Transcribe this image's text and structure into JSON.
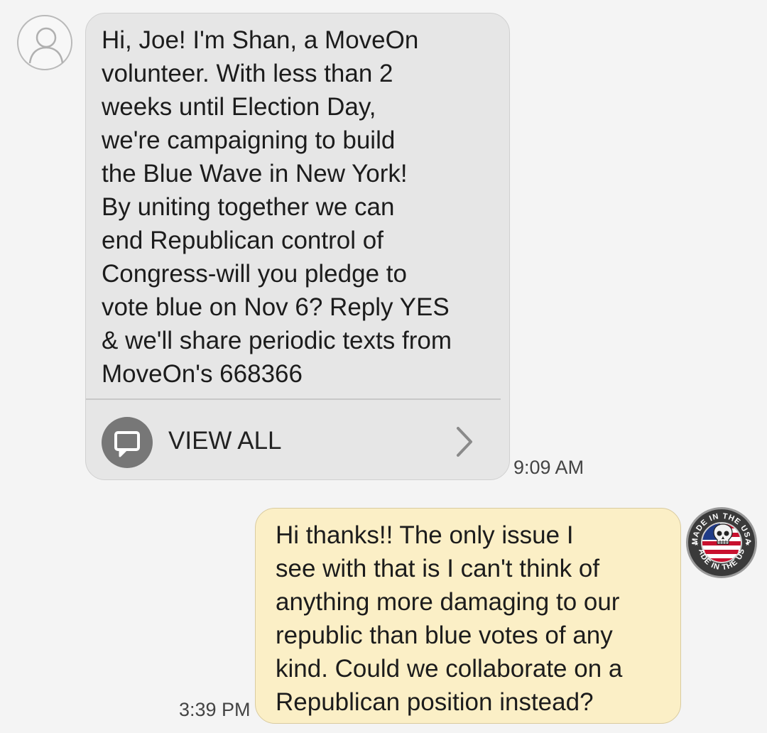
{
  "conversation": {
    "incoming": {
      "text": "Hi, Joe!  I'm Shan, a MoveOn\nvolunteer. With less than 2\nweeks until Election Day,\nwe're campaigning to build\nthe Blue Wave in New York!\nBy uniting together we can\nend Republican control of\nCongress-will you pledge to\nvote blue on Nov 6? Reply YES\n& we'll share periodic texts from\nMoveOn's 668366",
      "view_all_label": "VIEW ALL",
      "time": "9:09 AM",
      "avatar_icon": "person-outline-icon"
    },
    "outgoing": {
      "text": "Hi thanks!! The only issue I\nsee with that is I can't think of\nanything more damaging to our\nrepublic than blue votes of any\nkind. Could we collaborate on a\nRepublican position instead?",
      "time": "3:39 PM",
      "avatar_icon": "made-in-the-usa-badge-icon",
      "badge_text": "MADE IN THE USA"
    }
  },
  "colors": {
    "background": "#f4f4f4",
    "incoming_bubble": "#e6e6e6",
    "outgoing_bubble": "#fbefc6",
    "icon_gray": "#777777"
  }
}
